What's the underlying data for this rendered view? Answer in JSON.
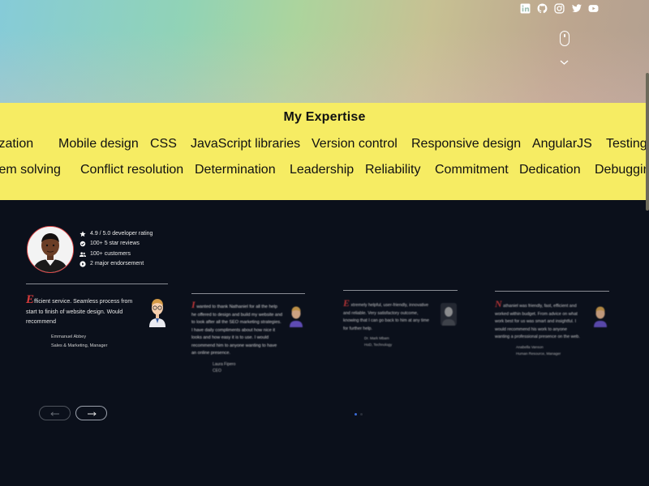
{
  "social": {
    "icons": [
      "linkedin-icon",
      "github-icon",
      "instagram-icon",
      "twitter-icon",
      "youtube-icon"
    ]
  },
  "expertise": {
    "title": "My Expertise",
    "row1": [
      "nization",
      "Mobile design",
      "CSS",
      "JavaScript libraries",
      "Version control",
      "Responsive design",
      "AngularJS",
      "Testing"
    ],
    "row2": [
      "blem solving",
      "Conflict resolution",
      "Determination",
      "Leadership",
      "Reliability",
      "Commitment",
      "Dedication",
      "Debuggin"
    ]
  },
  "profile": {
    "rating": "4.9 / 5.0 developer rating",
    "reviews": "100+ 5 star reviews",
    "customers": "100+ customers",
    "endorsements": "2 major endorsement"
  },
  "testimonials": [
    {
      "initial": "E",
      "text_lines": [
        "fficient service. Seamless process from",
        "start to finish of website design. Would",
        "recommend"
      ],
      "author": "Emmanuel Abbey",
      "role": "Sales & Marketing, Manager"
    },
    {
      "initial": "I",
      "text_lines": [
        "wanted to thank Nathaniel for all the help",
        "he offered to design and build my website and",
        "to look after all the SEO marketing strategies.",
        "I have daily compliments about how nice it",
        "looks and how easy it is to use. I would",
        "recommend him to anyone wanting to have",
        "an online presence."
      ],
      "author": "Laura Fipero",
      "role": "CEO"
    },
    {
      "initial": "E",
      "text_lines": [
        "xtremely helpful, user-friendly, innovative",
        "and reliable. Very satisfactory outcome,",
        "knowing that I can go back to him at any time",
        "for further help."
      ],
      "author": "Dr. Mark Mbam",
      "role": "HoD, Technology"
    },
    {
      "initial": "N",
      "text_lines": [
        "athaniel was friendly, fast, efficient and",
        "worked within budget. From advice on what",
        "work best for us was smart and insightful. I",
        "would recommend his work to anyone",
        "wanting a professional presence on the web."
      ],
      "author": "Anabella Vanson",
      "role": "Human Resource, Manager"
    }
  ],
  "nav": {
    "prev_icon": "arrow-left-icon",
    "next_icon": "arrow-right-icon"
  },
  "colors": {
    "expertise_bg": "#f6ec63",
    "dark_bg": "#0b101b",
    "quote_accent": "#d83c3c",
    "dot_active": "#3a6bd8"
  }
}
